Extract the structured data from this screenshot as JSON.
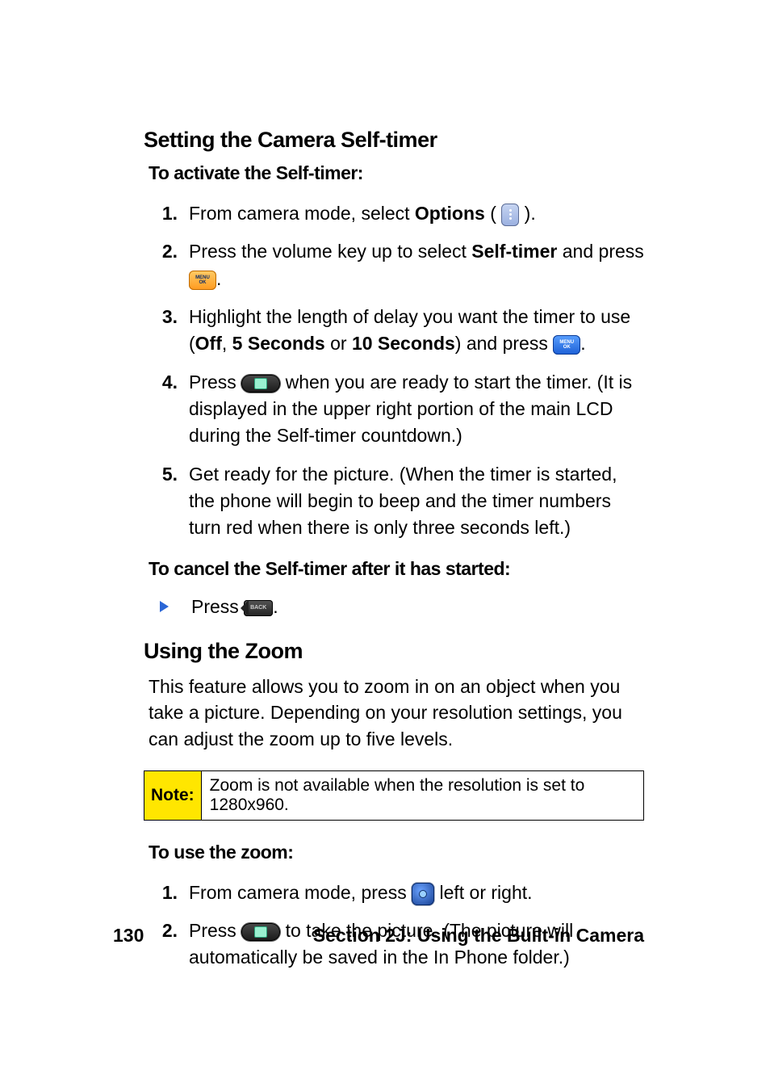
{
  "section1": {
    "title": "Setting the Camera Self-timer",
    "subhead": "To activate the Self-timer:",
    "steps": [
      {
        "num": "1.",
        "pre": "From camera mode, select ",
        "bold": "Options",
        "post": " ( ",
        "post2": " )."
      },
      {
        "num": "2.",
        "pre": "Press the volume key up to select ",
        "bold": "Self-timer",
        "post": " and press ",
        "post2": "."
      },
      {
        "num": "3.",
        "pre": "Highlight the length of delay you want the timer to use (",
        "bold": "Off",
        "mid1": ", ",
        "bold2": "5 Seconds",
        "mid2": " or ",
        "bold3": "10 Seconds",
        "post": ") and press ",
        "post2": "."
      },
      {
        "num": "4.",
        "pre": "Press ",
        "post": " when you are ready to start the timer. (It is displayed in the upper right portion of the main LCD during the Self-timer countdown.)"
      },
      {
        "num": "5.",
        "text": "Get ready for the picture. (When the timer is started, the phone will begin to beep and the timer numbers turn red when there is only three seconds left.)"
      }
    ],
    "cancel_head": "To cancel the Self-timer after it has started:",
    "cancel_item": {
      "pre": "Press ",
      "post": "."
    }
  },
  "section2": {
    "title": "Using the Zoom",
    "body": "This feature allows you to zoom in on an object when you take a picture. Depending on your resolution settings, you can adjust the zoom up to five levels.",
    "note_label": "Note:",
    "note_text": "Zoom is not available when the resolution is set to 1280x960.",
    "subhead": "To use the zoom:",
    "steps": [
      {
        "num": "1.",
        "pre": "From camera mode, press ",
        "post": " left or right."
      },
      {
        "num": "2.",
        "pre": "Press ",
        "post": " to take the picture. (The picture will automatically be saved in the In Phone folder.)"
      }
    ]
  },
  "footer": {
    "page": "130",
    "section": "Section 2J: Using the Built-in Camera"
  },
  "icons": {
    "menu_top": "MENU",
    "menu_bottom": "OK",
    "back": "BACK"
  }
}
